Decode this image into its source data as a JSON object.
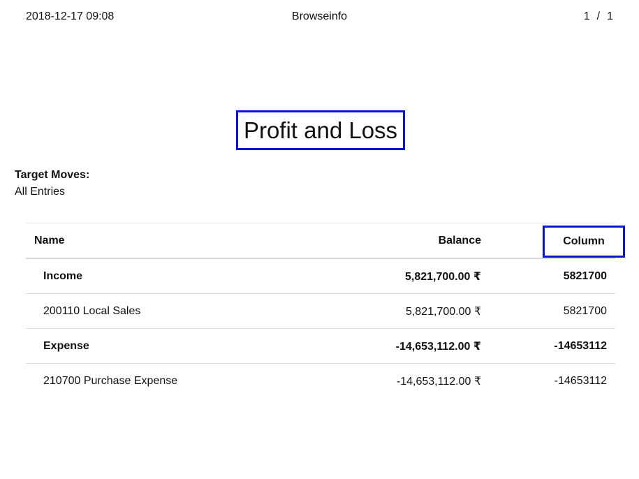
{
  "page_header": {
    "datetime": "2018-12-17 09:08",
    "company": "Browseinfo",
    "page_current": "1",
    "page_sep": "/",
    "page_total": "1"
  },
  "report": {
    "title": "Profit and Loss",
    "target_moves_label": "Target Moves:",
    "target_moves_value": "All Entries"
  },
  "table": {
    "headers": {
      "name": "Name",
      "balance": "Balance",
      "column": "Column"
    },
    "rows": [
      {
        "name": "Income",
        "balance": "5,821,700.00 ₹",
        "column": "5821700",
        "bold": true
      },
      {
        "name": "200110 Local Sales",
        "balance": "5,821,700.00 ₹",
        "column": "5821700",
        "bold": false
      },
      {
        "name": "Expense",
        "balance": "-14,653,112.00 ₹",
        "column": "-14653112",
        "bold": true
      },
      {
        "name": "210700 Purchase Expense",
        "balance": "-14,653,112.00 ₹",
        "column": "-14653112",
        "bold": false
      }
    ]
  },
  "colors": {
    "highlight_box": "#0a14d4",
    "text": "#111111",
    "row_divider": "#dedede"
  }
}
